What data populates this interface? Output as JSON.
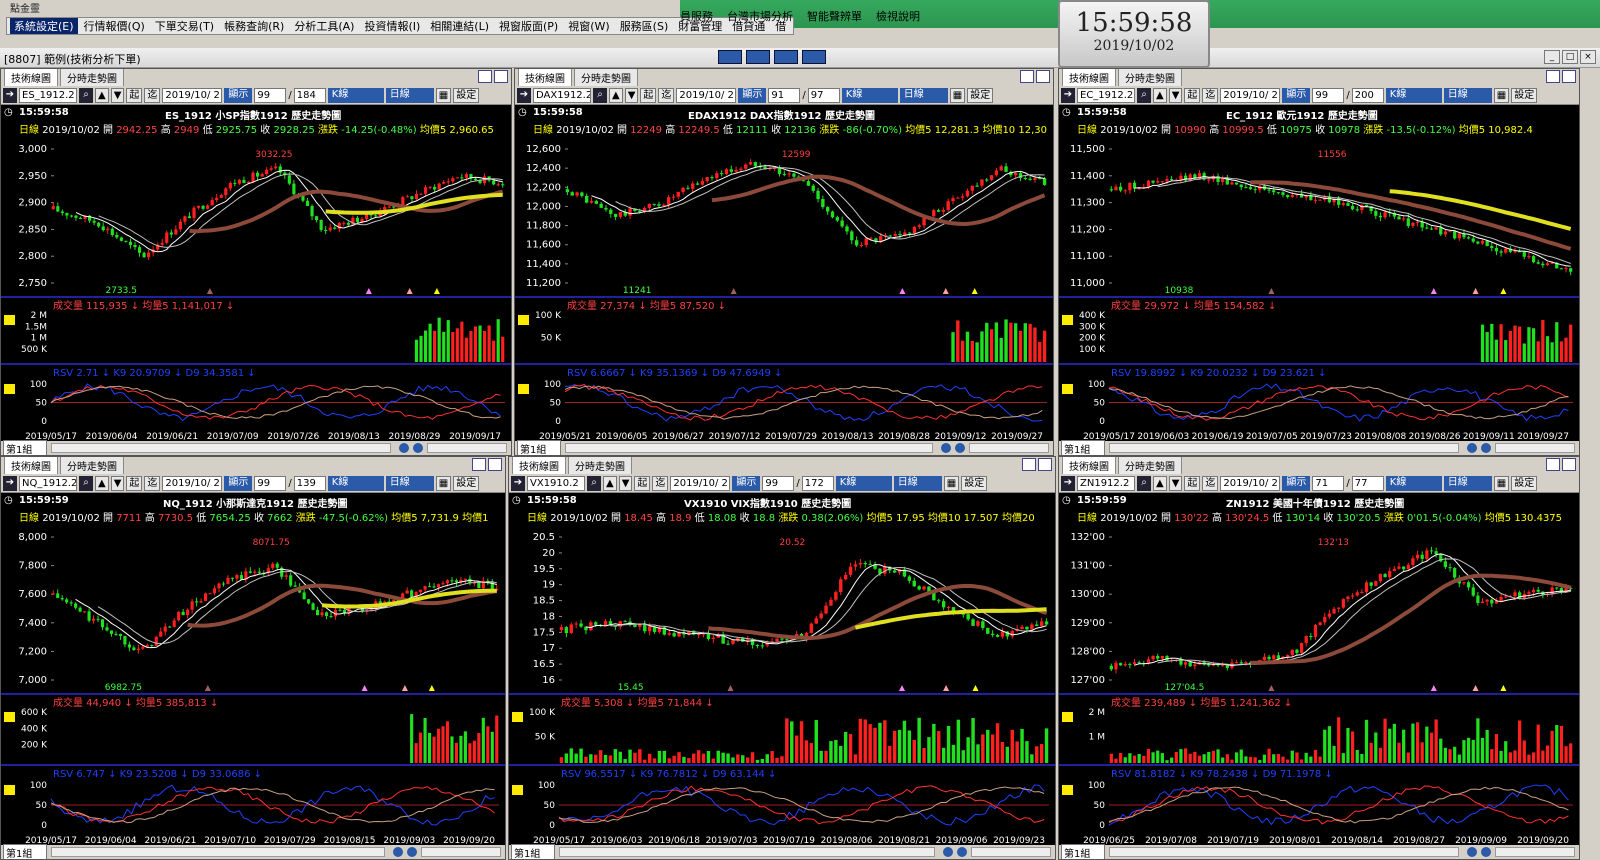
{
  "app": {
    "title": "點金靈",
    "menu": [
      "系統設定(E)",
      "行情報價(Q)",
      "下單交易(T)",
      "帳務查詢(R)",
      "分析工具(A)",
      "投資情報(I)",
      "相關連結(L)",
      "視窗版面(P)",
      "視窗(W)",
      "服務區(S)",
      "財富管理",
      "借貸通",
      "借"
    ],
    "menu2": [
      "員服務",
      "台灣市場分析",
      "智能聲辨單",
      "檢視說明"
    ],
    "window_title": "[8807] 範例(技術分析下單)",
    "clock_time": "15:59:58",
    "clock_date": "2019/10/02"
  },
  "labels": {
    "tab1": "技術線圖",
    "tab2": "分時走勢圖",
    "show": "顯示",
    "kline": "K線",
    "daily": "日線",
    "setting": "設定",
    "daily_label": "日線",
    "vol_label": "成交量",
    "ma5vol": "均量5",
    "rsv": "RSV",
    "k9": "K9",
    "d9": "D9",
    "group": "第1組",
    "start": "起",
    "end": "迄",
    "history": "歷史走勢圖"
  },
  "panels": [
    {
      "symbol": "ES_1912.2",
      "date": "2019/10/ 2",
      "show1": "99",
      "show2": "184",
      "time": "15:59:58",
      "name": "ES_1912 小SP指數1912",
      "open": "2942.25",
      "high": "2949",
      "low": "2925.75",
      "close": "2928.25",
      "change": "-14.25(-0.48%)",
      "ma": "均價5 2,960.65",
      "vol": "115,935",
      "volma": "1,141,017",
      "rsv": "2.71",
      "k9": "20.9709",
      "d9": "34.3581",
      "yticks": [
        "3,000",
        "2,950",
        "2,900",
        "2,850",
        "2,800",
        "2,750"
      ],
      "vticks": [
        "2 M",
        "1.5M",
        "1 M",
        "500 K"
      ],
      "xticks": [
        "2019/05/17",
        "2019/06/04",
        "2019/06/21",
        "2019/07/09",
        "2019/07/26",
        "2019/08/13",
        "2019/08/29",
        "2019/09/17"
      ],
      "hi_label": "3032.25",
      "lo_label": "2733.5"
    },
    {
      "symbol": "DAX1912.2",
      "date": "2019/10/ 2",
      "show1": "91",
      "show2": "97",
      "time": "15:59:58",
      "name": "EDAX1912 DAX指數1912",
      "open": "12249",
      "high": "12249.5",
      "low": "12111",
      "close": "12136",
      "change": "-86(-0.70%)",
      "ma": "均價5 12,281.3 均價10 12,30",
      "vol": "27,374",
      "volma": "87,520",
      "rsv": "6.6667",
      "k9": "35.1369",
      "d9": "47.6949",
      "yticks": [
        "12,600",
        "12,400",
        "12,200",
        "12,000",
        "11,800",
        "11,600",
        "11,400",
        "11,200"
      ],
      "vticks": [
        "100 K",
        "50 K"
      ],
      "xticks": [
        "2019/05/21",
        "2019/06/05",
        "2019/06/27",
        "2019/07/12",
        "2019/07/29",
        "2019/08/13",
        "2019/08/28",
        "2019/09/12",
        "2019/09/27"
      ],
      "hi_label": "12599",
      "lo_label": "11241"
    },
    {
      "symbol": "EC_1912.2",
      "date": "2019/10/ 2",
      "show1": "99",
      "show2": "200",
      "time": "15:59:58",
      "name": "EC_1912 歐元1912",
      "open": "10990",
      "high": "10999.5",
      "low": "10975",
      "close": "10978",
      "change": "-13.5(-0.12%)",
      "ma": "均價5 10,982.4",
      "vol": "29,972",
      "volma": "154,582",
      "rsv": "19.8992",
      "k9": "20.0232",
      "d9": "23.621",
      "yticks": [
        "11,500",
        "11,400",
        "11,300",
        "11,200",
        "11,100",
        "11,000"
      ],
      "vticks": [
        "400 K",
        "300 K",
        "200 K",
        "100 K"
      ],
      "xticks": [
        "2019/05/17",
        "2019/06/03",
        "2019/06/19",
        "2019/07/05",
        "2019/07/23",
        "2019/08/08",
        "2019/08/26",
        "2019/09/11",
        "2019/09/27"
      ],
      "hi_label": "11556",
      "lo_label": "10938"
    },
    {
      "symbol": "NQ_1912.2",
      "date": "2019/10/ 2",
      "show1": "99",
      "show2": "139",
      "time": "15:59:59",
      "name": "NQ_1912 小那斯達克1912",
      "open": "7711",
      "high": "7730.5",
      "low": "7654.25",
      "close": "7662",
      "change": "-47.5(-0.62%)",
      "ma": "均價5 7,731.9 均價1",
      "vol": "44,940",
      "volma": "385,813",
      "rsv": "6.747",
      "k9": "23.5208",
      "d9": "33.0686",
      "yticks": [
        "8,000",
        "7,800",
        "7,600",
        "7,400",
        "7,200",
        "7,000"
      ],
      "vticks": [
        "600 K",
        "400 K",
        "200 K"
      ],
      "xticks": [
        "2019/05/17",
        "2019/06/04",
        "2019/06/21",
        "2019/07/10",
        "2019/07/29",
        "2019/08/15",
        "2019/09/03",
        "2019/09/20"
      ],
      "hi_label": "8071.75",
      "lo_label": "6982.75"
    },
    {
      "symbol": "VX1910.2",
      "date": "2019/10/ 2",
      "show1": "99",
      "show2": "172",
      "time": "15:59:58",
      "name": "VX1910 VIX指數1910",
      "open": "18.45",
      "high": "18.9",
      "low": "18.08",
      "close": "18.8",
      "change": "0.38(2.06%)",
      "ma": "均價5 17.95 均價10 17.507 均價20",
      "vol": "5,308",
      "volma": "71,844",
      "rsv": "96.5517",
      "k9": "76.7812",
      "d9": "63.144",
      "yticks": [
        "20.5",
        "20",
        "19.5",
        "19",
        "18.5",
        "18",
        "17.5",
        "17",
        "16.5",
        "16"
      ],
      "vticks": [
        "100 K",
        "50 K"
      ],
      "xticks": [
        "2019/05/17",
        "2019/06/03",
        "2019/06/18",
        "2019/07/03",
        "2019/07/19",
        "2019/08/06",
        "2019/08/21",
        "2019/09/06",
        "2019/09/23"
      ],
      "hi_label": "20.52",
      "lo_label": "15.45"
    },
    {
      "symbol": "ZN1912.2",
      "date": "2019/10/ 2",
      "show1": "71",
      "show2": "77",
      "time": "15:59:59",
      "name": "ZN1912 美國十年債1912",
      "open": "130'22",
      "high": "130'24.5",
      "low": "130'14",
      "close": "130'20.5",
      "change": "0'01.5(-0.04%)",
      "ma": "均價5 130.4375",
      "vol": "239,489",
      "volma": "1,241,362",
      "rsv": "81.8182",
      "k9": "78.2438",
      "d9": "71.1978",
      "yticks": [
        "132'00",
        "131'00",
        "130'00",
        "129'00",
        "128'00",
        "127'00"
      ],
      "vticks": [
        "2 M",
        "1 M"
      ],
      "xticks": [
        "2019/06/25",
        "2019/07/08",
        "2019/07/19",
        "2019/08/01",
        "2019/08/14",
        "2019/08/27",
        "2019/09/09",
        "2019/09/20"
      ],
      "hi_label": "132'13",
      "lo_label": "127'04.5"
    }
  ],
  "colors": {
    "up": "#ff2020",
    "down": "#20e020",
    "ma_brown": "#8b4a3a",
    "ma_yellow": "#e0e020",
    "rsv": "#2040ff",
    "k9": "#ff3030",
    "d9": "#c8a080",
    "grid": "#1a1a60"
  }
}
